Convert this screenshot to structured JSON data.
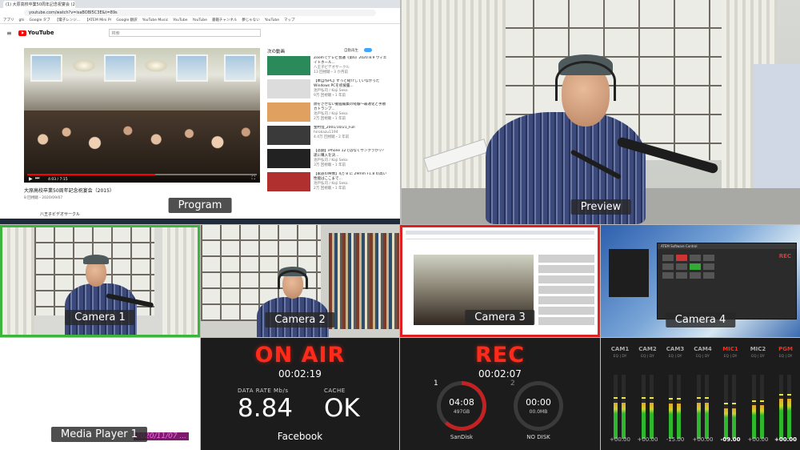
{
  "program": {
    "label": "Program",
    "browser": {
      "tab_title": "(1) 大原高校卒業50周年記念祝宴会 (2015...",
      "url": "youtube.com/watch?v=isaBOBI5C3E&t=89s",
      "bookmarks": [
        "アプリ",
        "ghi",
        "Google タブ",
        "【電子レンジ...",
        "【ATEM Mini Pr",
        "Google 翻訳",
        "YouTube Music",
        "YouTube",
        "YouTube",
        "書籍チャンネル",
        "夢じゃない",
        "YouTube",
        "マップ"
      ]
    },
    "youtube": {
      "logo": "YouTube",
      "search_placeholder": "検索",
      "video_time": "4:03 / 7:15",
      "video_title": "大原高校卒業50周年記念祝宴会（2015）",
      "video_meta": "8 回視聴・2020/09/07",
      "channel": "八王子ビデオサークル",
      "up_next": "次の動画",
      "autoplay_label": "自動再生"
    },
    "sidebar_videos": [
      {
        "title": "Zoomでテレビ会議《第6》2020.8.9 ウィエイトホール...",
        "channel": "八王子ビデオサークル",
        "views": "13 回視聴・3 か月前",
        "thumb": "#2a8a5a"
      },
      {
        "title": "【本自作PC】ずっと紹介していなかったWindows PCを初披露...",
        "channel": "池戸弘司 / Koji Seko",
        "views": "9万 回視聴・1 年前",
        "thumb": "#dcdcdc"
      },
      {
        "title": "顔をさせない動画編集の経験〜最適化と手順カトランプ...",
        "channel": "池戸弘司 / Koji Seko",
        "views": "2万 回視聴・1 年前",
        "thumb": "#e0a060"
      },
      {
        "title": "金村澄_2001/10/21_Full",
        "channel": "hirokazu1194",
        "views": "4.4万 回視聴・2 年前",
        "thumb": "#3a3a3a"
      },
      {
        "title": "【悲劇】iPhone 12ではなくサンクラがリ？遂に購入を決...",
        "channel": "池戸弘司 / Koji Seko",
        "views": "3万 回視聴・1 年前",
        "thumb": "#222222"
      },
      {
        "title": "【家族の映像】4万 8 に 29mm F1.8 の高い性能はここまで...",
        "channel": "池戸弘司 / Koji Seko",
        "views": "2万 回視聴・1 年前",
        "thumb": "#b03030"
      }
    ]
  },
  "preview": {
    "label": "Preview"
  },
  "cameras": [
    {
      "label": "Camera 1",
      "tally": "preview"
    },
    {
      "label": "Camera 2",
      "tally": "none"
    },
    {
      "label": "Camera 3",
      "tally": "program"
    },
    {
      "label": "Camera 4",
      "tally": "none"
    }
  ],
  "cam4_screen": {
    "window_title": "ATEM Software Control",
    "rec_text": "REC"
  },
  "media_player": {
    "label": "Media Player 1",
    "overlay": "2020/11/07 ..."
  },
  "on_air": {
    "title": "ON AIR",
    "time": "00:02:19",
    "data_rate_label": "DATA RATE Mb/s",
    "data_rate_value": "8.84",
    "cache_label": "CACHE",
    "cache_value": "OK",
    "platform": "Facebook"
  },
  "recording": {
    "title": "REC",
    "time": "00:02:07",
    "drives": [
      {
        "index": "1",
        "remaining": "04:08",
        "size": "497GB",
        "name": "SanDisk",
        "fill": 0.62,
        "color": "#c22222"
      },
      {
        "index": "2",
        "remaining": "00:00",
        "size": "00.0MB",
        "name": "NO DISK",
        "fill": 0,
        "color": "#555555"
      }
    ]
  },
  "audio": {
    "channels": [
      {
        "name": "CAM1",
        "eq": "EQ | DY",
        "level": 0.56,
        "db": "+00.00",
        "state": "off"
      },
      {
        "name": "CAM2",
        "eq": "EQ | DY",
        "level": 0.56,
        "db": "+00.00",
        "state": "off"
      },
      {
        "name": "CAM3",
        "eq": "EQ | DY",
        "level": 0.55,
        "db": "-15.00",
        "state": "off"
      },
      {
        "name": "CAM4",
        "eq": "EQ | DY",
        "level": 0.56,
        "db": "+00.00",
        "state": "off"
      },
      {
        "name": "MIC1",
        "eq": "EQ | DY",
        "level": 0.48,
        "db": "-09.00",
        "state": "active"
      },
      {
        "name": "MIC2",
        "eq": "EQ | DY",
        "level": 0.52,
        "db": "+00.00",
        "state": "off"
      },
      {
        "name": "PGM",
        "eq": "EQ | DY",
        "level": 0.62,
        "db": "+00.00",
        "state": "pgm"
      }
    ]
  }
}
